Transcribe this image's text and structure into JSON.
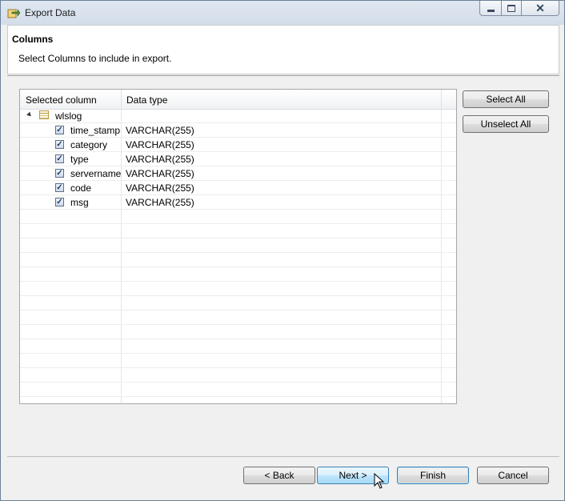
{
  "window": {
    "title": "Export Data",
    "icons": {
      "app": "export-icon",
      "minimize": "minimize-icon",
      "maximize": "maximize-icon",
      "close": "close-icon"
    }
  },
  "header": {
    "title": "Columns",
    "description": "Select Columns to include in export."
  },
  "table": {
    "columns": [
      "Selected column",
      "Data type"
    ],
    "root": {
      "label": "wlslog",
      "icon": "table-icon",
      "expanded": true
    },
    "rows": [
      {
        "name": "time_stamp",
        "type": "VARCHAR(255)",
        "checked": true
      },
      {
        "name": "category",
        "type": "VARCHAR(255)",
        "checked": true
      },
      {
        "name": "type",
        "type": "VARCHAR(255)",
        "checked": true
      },
      {
        "name": "servername",
        "type": "VARCHAR(255)",
        "checked": true
      },
      {
        "name": "code",
        "type": "VARCHAR(255)",
        "checked": true
      },
      {
        "name": "msg",
        "type": "VARCHAR(255)",
        "checked": true
      }
    ]
  },
  "side_buttons": {
    "select_all": "Select All",
    "unselect_all": "Unselect All"
  },
  "footer": {
    "back": "< Back",
    "next": "Next >",
    "finish": "Finish",
    "cancel": "Cancel"
  },
  "colors": {
    "accent": "#3c7fb1",
    "window_border": "#6b7f96"
  }
}
